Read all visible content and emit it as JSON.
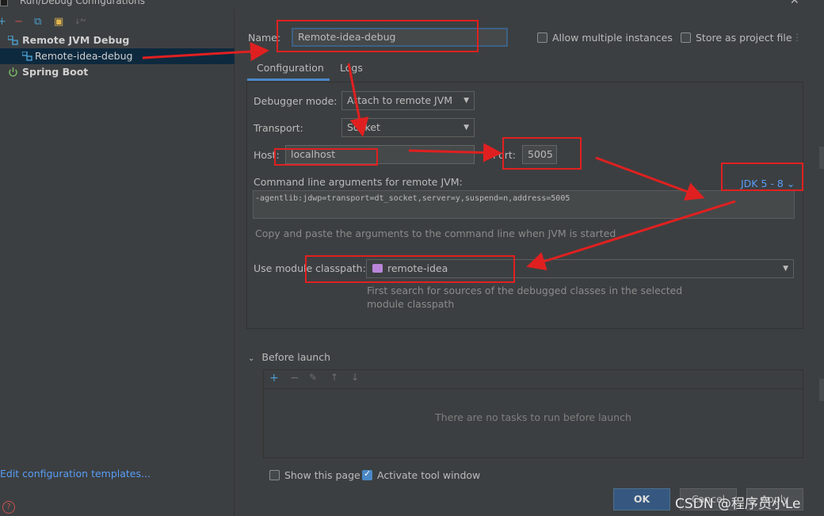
{
  "window": {
    "title": "Run/Debug Configurations",
    "close_glyph": "✕"
  },
  "left_toolbar": {
    "add": "+",
    "remove": "−",
    "copy": "⧉",
    "folder": "▣",
    "sort": "↓ᴬᶻ"
  },
  "tree": [
    {
      "label": "Remote JVM Debug",
      "type": "group"
    },
    {
      "label": "Remote-idea-debug",
      "type": "item",
      "selected": true
    },
    {
      "label": "Spring Boot",
      "type": "group"
    }
  ],
  "edit_templates": "Edit configuration templates...",
  "help_glyph": "?",
  "name_label": "Name:",
  "name_value": "Remote-idea-debug",
  "allow_multiple": {
    "label": "Allow multiple instances",
    "checked": false
  },
  "store_project": {
    "label": "Store as project file",
    "checked": false
  },
  "kebab": "⋮",
  "tabs": [
    {
      "label": "Configuration",
      "active": true
    },
    {
      "label": "Logs",
      "active": false
    }
  ],
  "debugger_mode": {
    "label": "Debugger mode:",
    "value": "Attach to remote JVM"
  },
  "transport": {
    "label": "Transport:",
    "value": "Socket"
  },
  "host": {
    "label": "Host:",
    "value": "localhost"
  },
  "port": {
    "label": "Port:",
    "value": "5005"
  },
  "cmd": {
    "label": "Command line arguments for remote JVM:",
    "jdk_link": "JDK 5 - 8 ⌄",
    "value": "-agentlib:jdwp=transport=dt_socket,server=y,suspend=n,address=5005",
    "hint": "Copy and paste the arguments to the command line when JVM is started"
  },
  "module": {
    "label": "Use module classpath:",
    "value": "remote-idea",
    "hint_line1": "First search for sources of the debugged classes in the selected",
    "hint_line2": "module classpath"
  },
  "before_launch": {
    "chevron": "⌄",
    "label": "Before launch",
    "toolbar": {
      "add": "+",
      "remove": "−",
      "edit": "✎",
      "up": "↑",
      "down": "↓"
    },
    "empty_text": "There are no tasks to run before launch"
  },
  "show_page": {
    "label": "Show this page",
    "checked": false
  },
  "activate_tool": {
    "label": "Activate tool window",
    "checked": true
  },
  "buttons": {
    "ok": "OK",
    "cancel": "Cancel",
    "apply": "Apply"
  },
  "watermark": "CSDN @程序员小Le",
  "colors": {
    "accent": "#4a88c7",
    "link": "#589df6",
    "annotation": "#e02020",
    "background": "#3c3f41"
  }
}
